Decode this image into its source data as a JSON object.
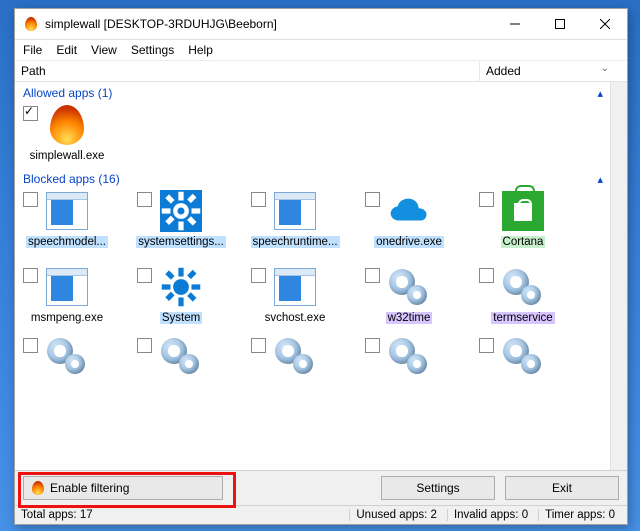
{
  "title": "simplewall [DESKTOP-3RDUHJG\\Beeborn]",
  "menu": {
    "file": "File",
    "edit": "Edit",
    "view": "View",
    "settings": "Settings",
    "help": "Help"
  },
  "columns": {
    "path": "Path",
    "added": "Added"
  },
  "sections": {
    "allowed": {
      "title": "Allowed apps (1)"
    },
    "blocked": {
      "title": "Blocked apps (16)"
    }
  },
  "allowed_items": [
    {
      "label": "simplewall.exe",
      "icon": "flame",
      "checked": true,
      "hl": ""
    }
  ],
  "blocked_rows": [
    [
      {
        "label": "speechmodel...",
        "icon": "winthumb",
        "hl": "hl-blue"
      },
      {
        "label": "systemsettings...",
        "icon": "gearwhite",
        "hl": "hl-blue"
      },
      {
        "label": "speechruntime...",
        "icon": "winthumb",
        "hl": "hl-blue"
      },
      {
        "label": "onedrive.exe",
        "icon": "cloud",
        "hl": "hl-blue"
      },
      {
        "label": "Cortana",
        "icon": "store",
        "hl": "hl-green"
      }
    ],
    [
      {
        "label": "msmpeng.exe",
        "icon": "winthumb",
        "hl": ""
      },
      {
        "label": "System",
        "icon": "gearblue",
        "hl": "hl-blue"
      },
      {
        "label": "svchost.exe",
        "icon": "winthumb",
        "hl": ""
      },
      {
        "label": "w32time",
        "icon": "gear2",
        "hl": "hl-violet"
      },
      {
        "label": "termservice",
        "icon": "gear2",
        "hl": "hl-violet"
      }
    ]
  ],
  "bottom": {
    "enable": "Enable filtering",
    "settings": "Settings",
    "exit": "Exit"
  },
  "status": {
    "total": "Total apps: 17",
    "unused": "Unused apps: 2",
    "invalid": "Invalid apps: 0",
    "timer": "Timer apps: 0"
  }
}
